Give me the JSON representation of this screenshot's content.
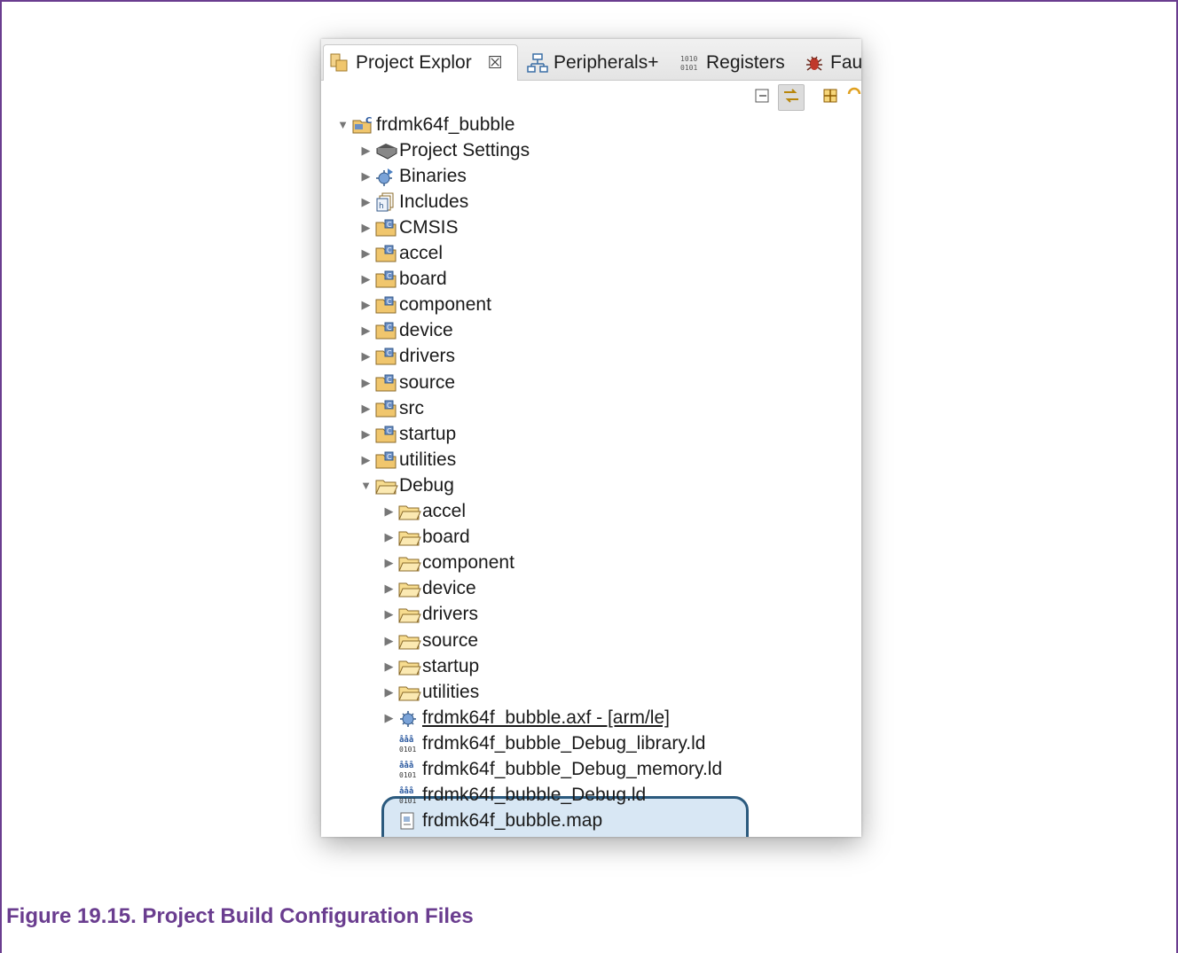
{
  "tabs": [
    {
      "label": "Project Explor",
      "icon": "project-explorer-icon",
      "active": true,
      "close_glyph": "☒"
    },
    {
      "label": "Peripherals+",
      "icon": "peripherals-icon",
      "active": false
    },
    {
      "label": "Registers",
      "icon": "registers-icon",
      "active": false
    },
    {
      "label": "Fau",
      "icon": "bug-icon",
      "active": false
    }
  ],
  "toolbar": [
    "collapse-all-icon",
    "link-with-editor-icon",
    "focus-icon",
    "sync-icon"
  ],
  "tree": [
    {
      "label": "frdmk64f_bubble",
      "icon": "c-project-icon",
      "level": 0,
      "twisty": "open"
    },
    {
      "label": "Project Settings",
      "icon": "settings-book-icon",
      "level": 1,
      "twisty": "closed"
    },
    {
      "label": "Binaries",
      "icon": "binaries-icon",
      "level": 1,
      "twisty": "closed"
    },
    {
      "label": "Includes",
      "icon": "includes-icon",
      "level": 1,
      "twisty": "closed"
    },
    {
      "label": "CMSIS",
      "icon": "source-folder-icon",
      "level": 1,
      "twisty": "closed"
    },
    {
      "label": "accel",
      "icon": "source-folder-icon",
      "level": 1,
      "twisty": "closed"
    },
    {
      "label": "board",
      "icon": "source-folder-icon",
      "level": 1,
      "twisty": "closed"
    },
    {
      "label": "component",
      "icon": "source-folder-icon",
      "level": 1,
      "twisty": "closed"
    },
    {
      "label": "device",
      "icon": "source-folder-icon",
      "level": 1,
      "twisty": "closed"
    },
    {
      "label": "drivers",
      "icon": "source-folder-icon",
      "level": 1,
      "twisty": "closed"
    },
    {
      "label": "source",
      "icon": "source-folder-icon",
      "level": 1,
      "twisty": "closed"
    },
    {
      "label": "src",
      "icon": "source-folder-icon",
      "level": 1,
      "twisty": "closed"
    },
    {
      "label": "startup",
      "icon": "source-folder-icon",
      "level": 1,
      "twisty": "closed"
    },
    {
      "label": "utilities",
      "icon": "source-folder-icon",
      "level": 1,
      "twisty": "closed"
    },
    {
      "label": "Debug",
      "icon": "folder-icon",
      "level": 1,
      "twisty": "open"
    },
    {
      "label": "accel",
      "icon": "folder-icon",
      "level": 2,
      "twisty": "closed"
    },
    {
      "label": "board",
      "icon": "folder-icon",
      "level": 2,
      "twisty": "closed"
    },
    {
      "label": "component",
      "icon": "folder-icon",
      "level": 2,
      "twisty": "closed"
    },
    {
      "label": "device",
      "icon": "folder-icon",
      "level": 2,
      "twisty": "closed"
    },
    {
      "label": "drivers",
      "icon": "folder-icon",
      "level": 2,
      "twisty": "closed"
    },
    {
      "label": "source",
      "icon": "folder-icon",
      "level": 2,
      "twisty": "closed"
    },
    {
      "label": "startup",
      "icon": "folder-icon",
      "level": 2,
      "twisty": "closed"
    },
    {
      "label": "utilities",
      "icon": "folder-icon",
      "level": 2,
      "twisty": "closed"
    },
    {
      "label": "frdmk64f_bubble.axf - [arm/le]",
      "icon": "binary-axf-icon",
      "level": 2,
      "twisty": "closed"
    },
    {
      "label": "frdmk64f_bubble_Debug_library.ld",
      "icon": "linker-script-icon",
      "level": 2,
      "twisty": "none"
    },
    {
      "label": "frdmk64f_bubble_Debug_memory.ld",
      "icon": "linker-script-icon",
      "level": 2,
      "twisty": "none"
    },
    {
      "label": "frdmk64f_bubble_Debug.ld",
      "icon": "linker-script-icon",
      "level": 2,
      "twisty": "none"
    },
    {
      "label": "frdmk64f_bubble.map",
      "icon": "map-file-icon",
      "level": 2,
      "twisty": "none"
    }
  ],
  "glyphs": {
    "twisty_open": "▼",
    "twisty_closed": "▶"
  },
  "colors": {
    "highlight_fill": "#d8e7f4",
    "highlight_border": "#2b5a7e",
    "caption": "#6a3d8f"
  },
  "caption": "Figure 19.15. Project Build Configuration Files"
}
